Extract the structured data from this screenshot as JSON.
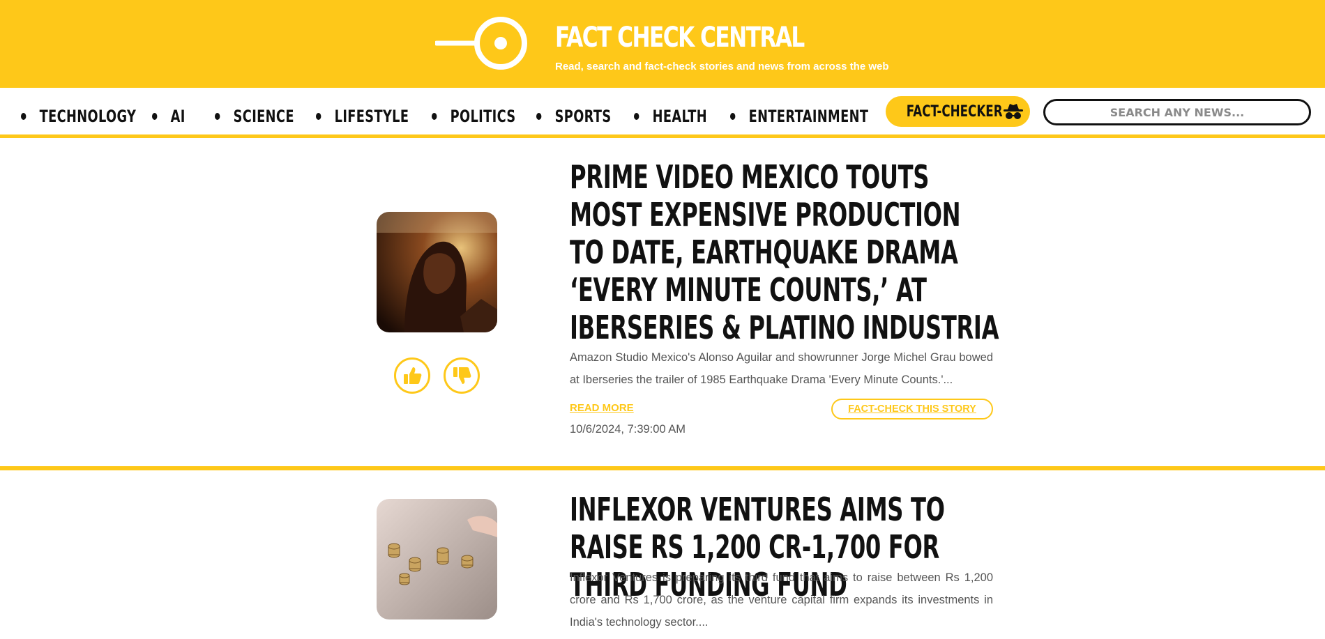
{
  "header": {
    "title": "FACT CHECK CENTRAL",
    "tagline": "Read, search and fact-check stories and news from across the web",
    "logo_icon": "magnifier-logo-icon",
    "background_color": "#fec819"
  },
  "nav": {
    "items": [
      {
        "label": "TECHNOLOGY"
      },
      {
        "label": "AI"
      },
      {
        "label": "SCIENCE"
      },
      {
        "label": "LIFESTYLE"
      },
      {
        "label": "POLITICS"
      },
      {
        "label": "SPORTS"
      },
      {
        "label": "HEALTH"
      },
      {
        "label": "ENTERTAINMENT"
      }
    ],
    "fact_checker_label": "FACT-CHECKER",
    "fact_checker_icon": "spy-icon",
    "search_placeholder": "SEARCH ANY NEWS..."
  },
  "articles": [
    {
      "headline": "PRIME VIDEO MEXICO TOUTS MOST EXPENSIVE PRODUCTION TO DATE, EARTHQUAKE DRAMA ‘EVERY MINUTE COUNTS,’ AT IBERSERIES & PLATINO INDUSTRIA",
      "summary": "Amazon Studio Mexico's Alonso Aguilar and showrunner Jorge Michel Grau bowed at Iberseries the trailer of 1985 Earthquake Drama 'Every Minute Counts.'...",
      "read_more": "READ MORE",
      "fact_check": "FACT-CHECK THIS STORY",
      "timestamp": "10/6/2024, 7:39:00 AM",
      "thumb_icon": "article-thumbnail-image"
    },
    {
      "headline": "INFLEXOR VENTURES AIMS TO RAISE RS 1,200 CR-1,700 FOR THIRD FUNDING FUND",
      "summary": "Inflexor Ventures is preparing its third fund that aims to raise between Rs 1,200 crore and Rs 1,700 crore, as the venture capital firm expands its investments in India's technology sector....",
      "thumb_icon": "article-thumbnail-image"
    }
  ],
  "colors": {
    "accent": "#fec819",
    "text": "#111111",
    "muted": "#555555"
  }
}
